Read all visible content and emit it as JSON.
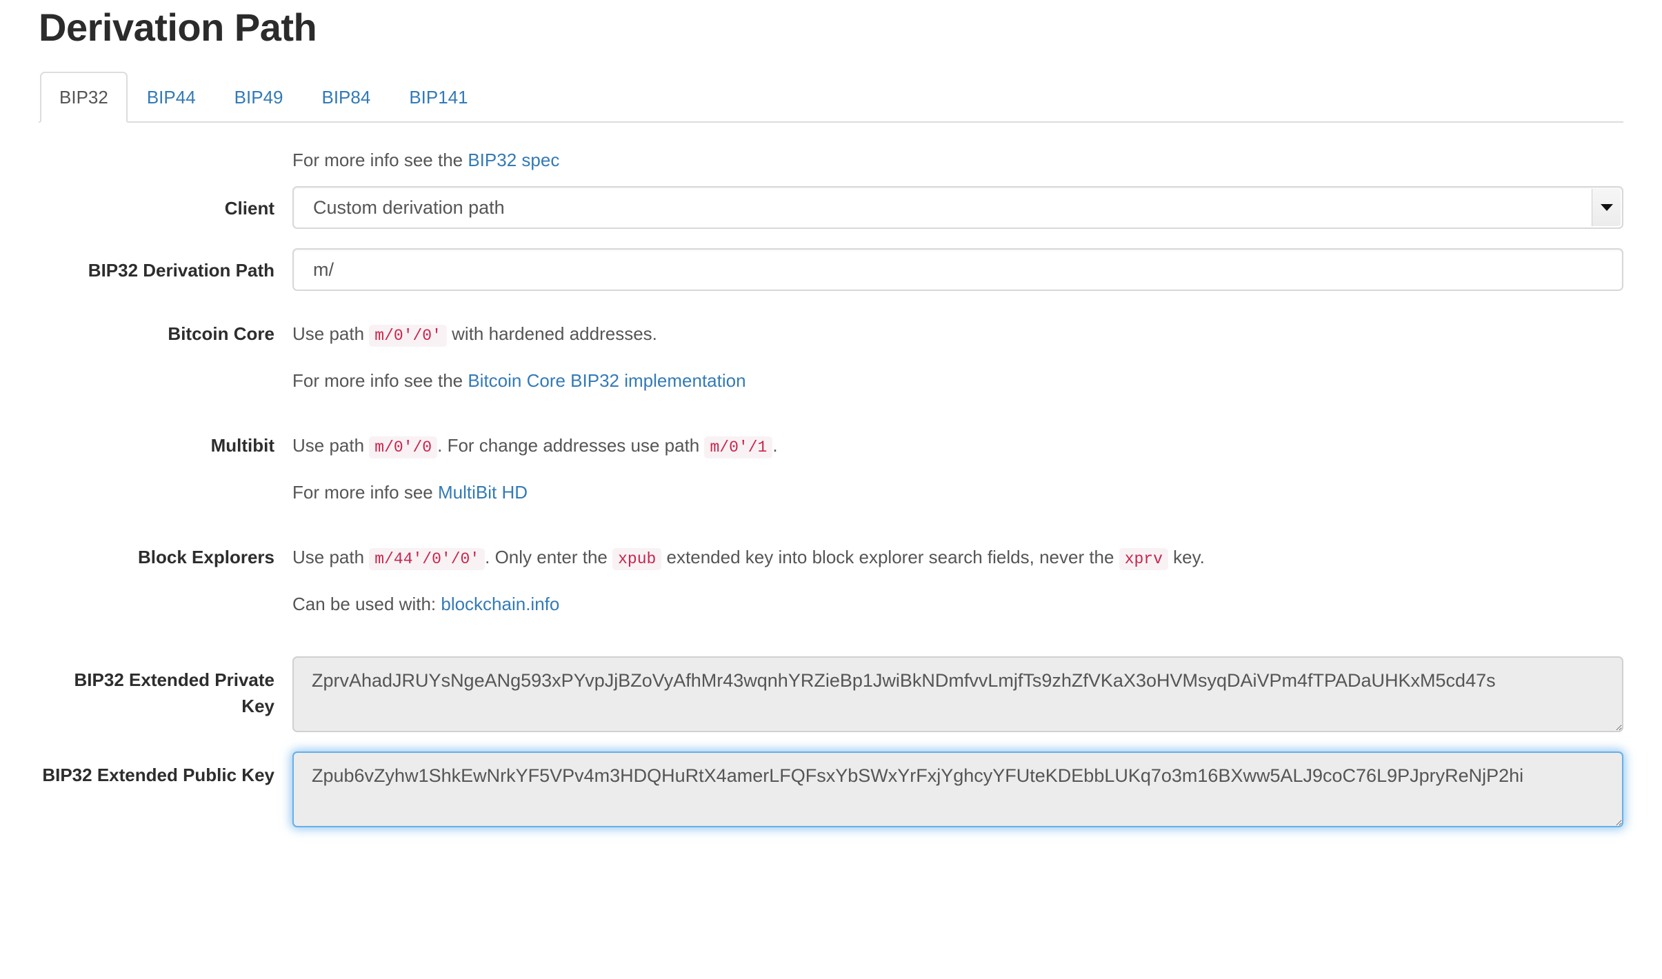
{
  "page": {
    "title": "Derivation Path"
  },
  "tabs": [
    {
      "label": "BIP32",
      "active": true
    },
    {
      "label": "BIP44",
      "active": false
    },
    {
      "label": "BIP49",
      "active": false
    },
    {
      "label": "BIP84",
      "active": false
    },
    {
      "label": "BIP141",
      "active": false
    }
  ],
  "spec_note": {
    "text": "For more info see the ",
    "link": "BIP32 spec"
  },
  "client": {
    "label": "Client",
    "value": "Custom derivation path",
    "options": [
      "Custom derivation path"
    ],
    "dropdown_icon": "chevron-down-icon"
  },
  "derivation_path": {
    "label": "BIP32 Derivation Path",
    "value": "m/",
    "placeholder": "m/"
  },
  "bitcoin_core": {
    "label": "Bitcoin Core",
    "line1_pre": "Use path ",
    "line1_code": "m/0'/0'",
    "line1_post": " with hardened addresses.",
    "line2_pre": "For more info see the ",
    "line2_link": "Bitcoin Core BIP32 implementation"
  },
  "multibit": {
    "label": "Multibit",
    "line1_pre": "Use path ",
    "line1_code1": "m/0'/0",
    "line1_mid": ". For change addresses use path ",
    "line1_code2": "m/0'/1",
    "line1_post": ".",
    "line2_pre": "For more info see ",
    "line2_link": "MultiBit HD"
  },
  "block_explorers": {
    "label": "Block Explorers",
    "line1_pre": "Use path ",
    "line1_code1": "m/44'/0'/0'",
    "line1_mid1": ". Only enter the ",
    "line1_code2": "xpub",
    "line1_mid2": " extended key into block explorer search fields, never the ",
    "line1_code3": "xprv",
    "line1_post": " key.",
    "line2_pre": "Can be used with: ",
    "line2_link": "blockchain.info"
  },
  "extended_private_key": {
    "label": "BIP32 Extended Private Key",
    "value": "ZprvAhadJRUYsNgeANg593xPYvpJjBZoVyAfhMr43wqnhYRZieBp1JwiBkNDmfvvLmjfTs9zhZfVKaX3oHVMsyqDAiVPm4fTPADaUHKxM5cd47s"
  },
  "extended_public_key": {
    "label": "BIP32 Extended Public Key",
    "value": "Zpub6vZyhw1ShkEwNrkYF5VPv4m3HDQHuRtX4amerLFQFsxYbSWxYrFxjYghcyYFUteKDEbbLUKq7o3m16BXww5ALJ9coC76L9PJpryReNjP2hi",
    "focused": true
  },
  "colors": {
    "link": "#337ab7",
    "code_text": "#c7254e",
    "code_bg": "#f9f2f4",
    "focus_ring": "#66afe9",
    "textarea_bg": "#ececec"
  }
}
